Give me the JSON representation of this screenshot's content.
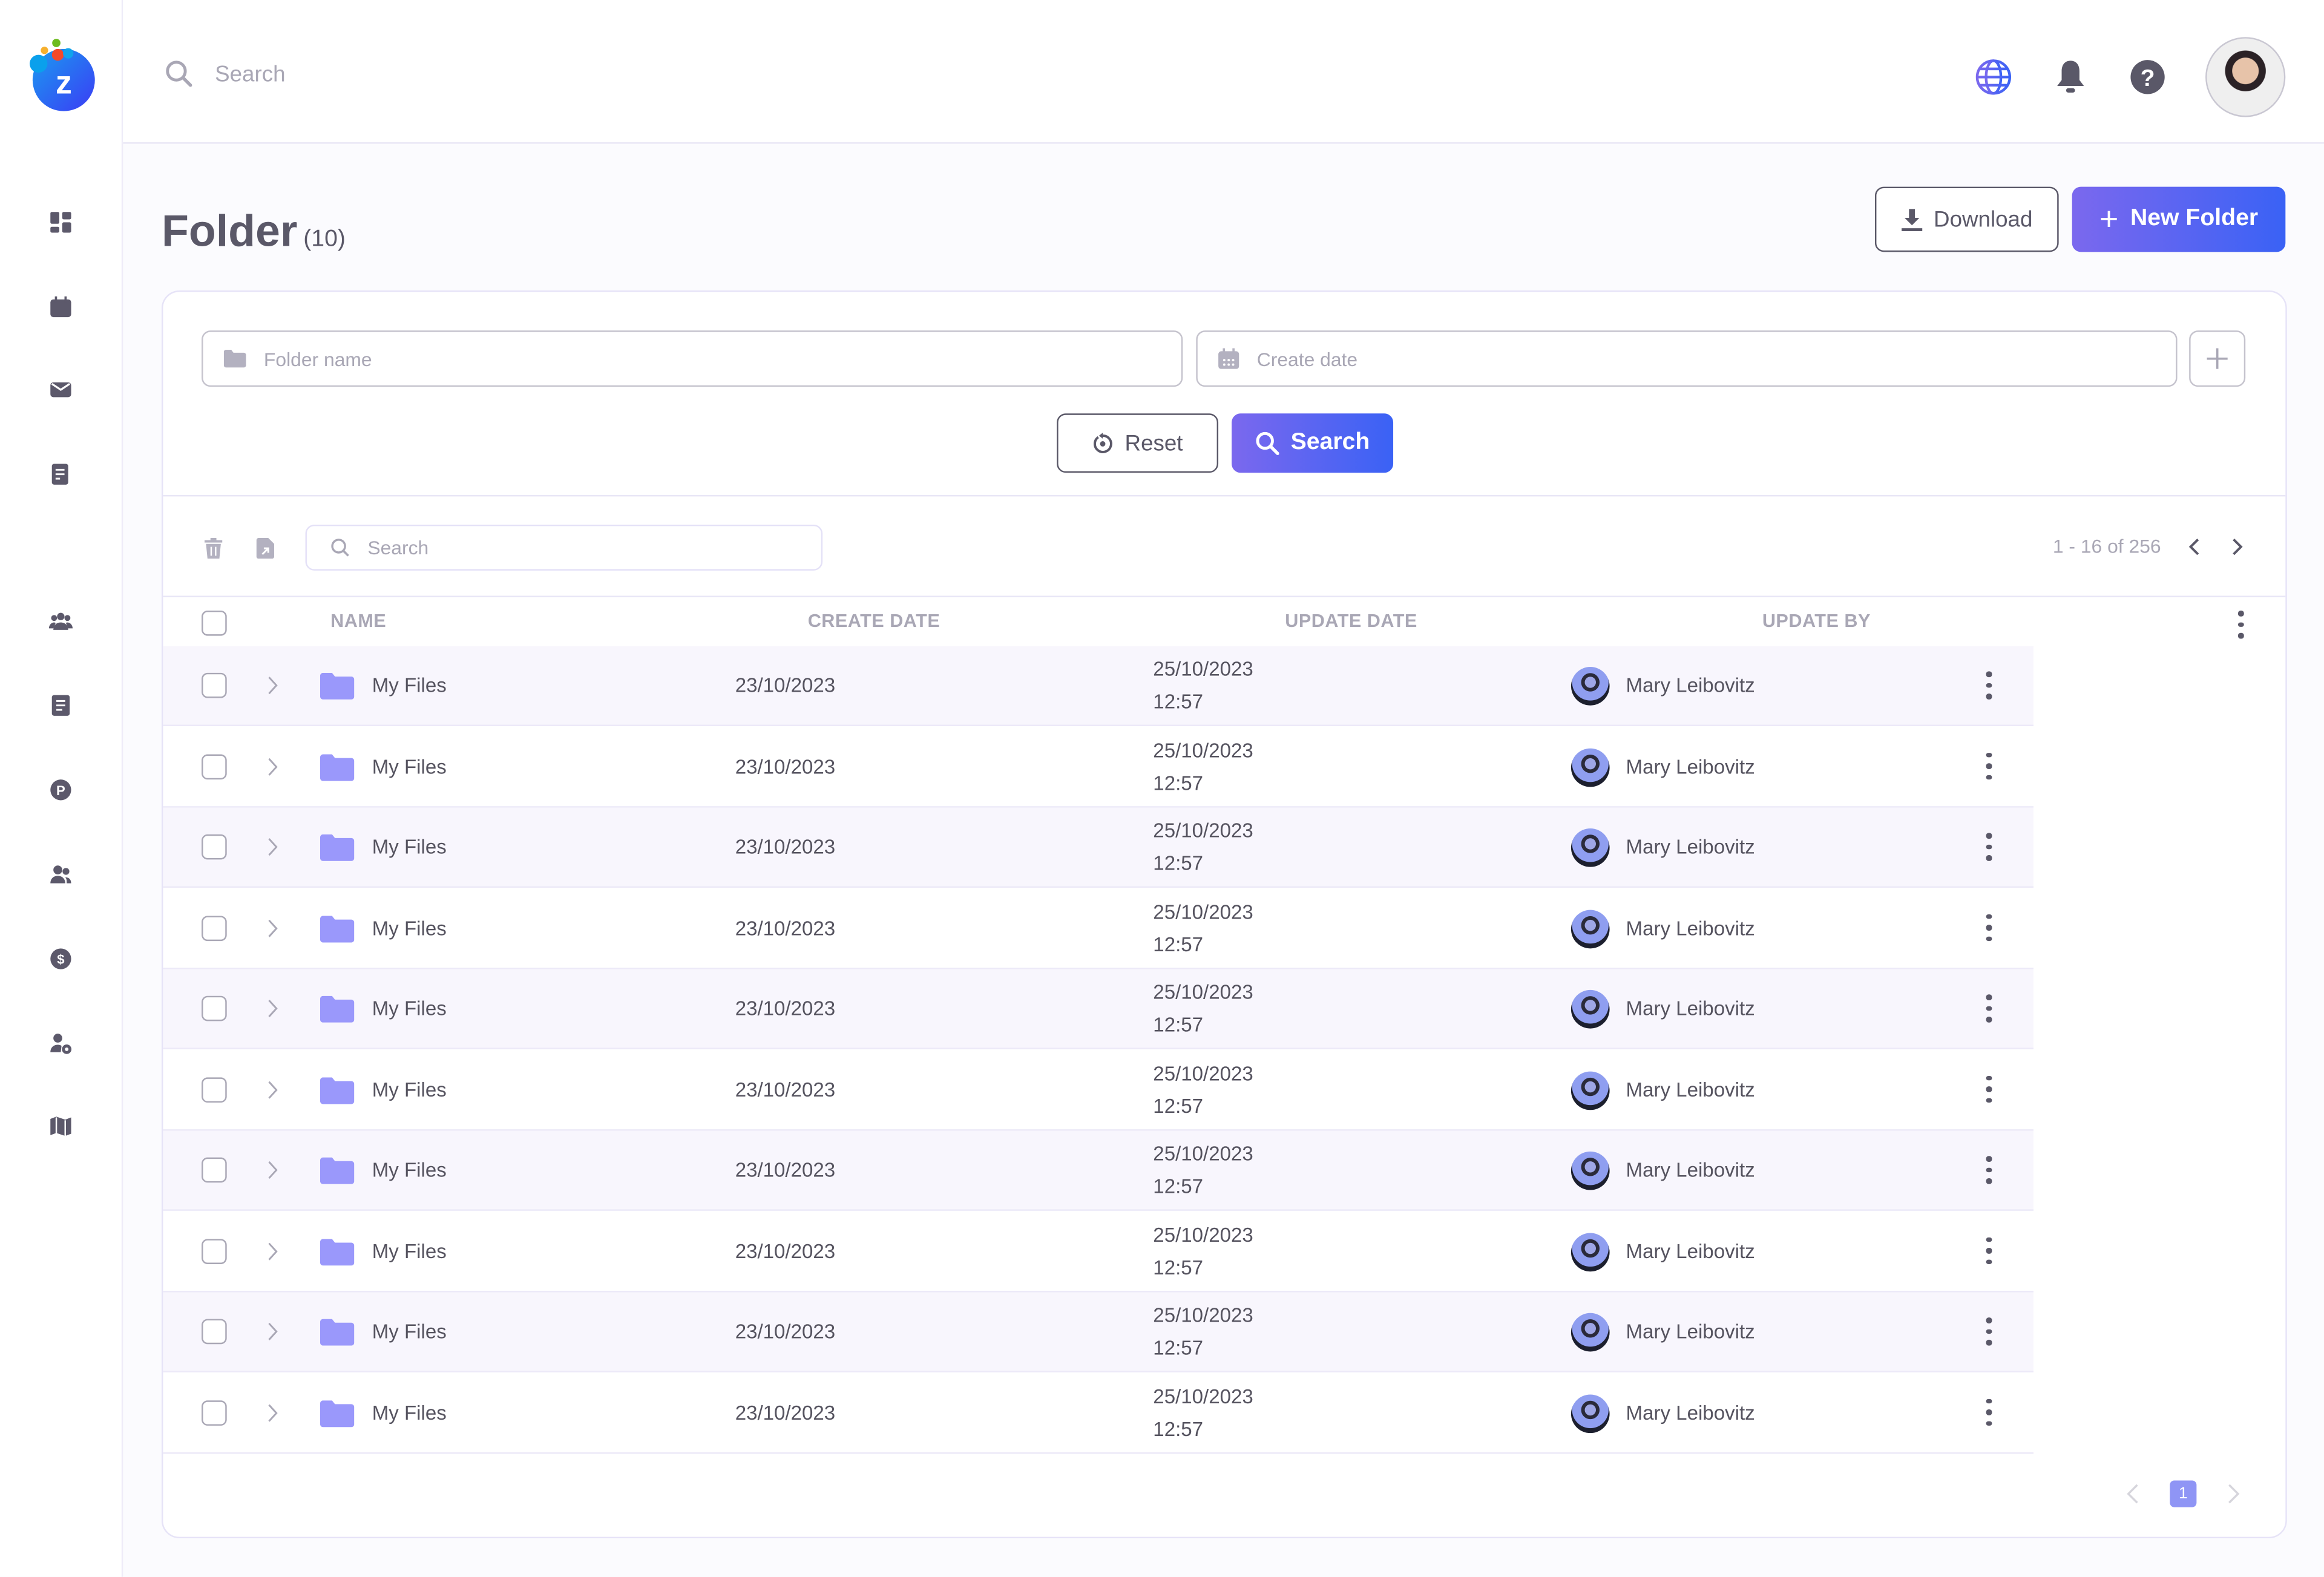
{
  "header": {
    "search_placeholder": "Search",
    "icons": [
      "globe-icon",
      "bell-icon",
      "help-icon"
    ]
  },
  "sidebar": {
    "items": [
      "dashboard",
      "calendar",
      "mail",
      "checklist",
      "team",
      "document",
      "points",
      "users",
      "billing",
      "user-settings",
      "map"
    ]
  },
  "page": {
    "title": "Folder",
    "count": "(10)",
    "download_label": "Download",
    "new_folder_label": "New Folder"
  },
  "filters": {
    "folder_name_placeholder": "Folder name",
    "create_date_placeholder": "Create date",
    "reset_label": "Reset",
    "search_label": "Search"
  },
  "table_toolbar": {
    "search_placeholder": "Search",
    "range": "1 - 16 of 256"
  },
  "columns": {
    "name": "NAME",
    "create_date": "CREATE DATE",
    "update_date": "UPDATE DATE",
    "update_by": "UPDATE BY"
  },
  "rows": [
    {
      "name": "My Files",
      "create_date": "23/10/2023",
      "update_date": "25/10/2023",
      "update_time": "12:57",
      "update_by": "Mary Leibovitz"
    },
    {
      "name": "My Files",
      "create_date": "23/10/2023",
      "update_date": "25/10/2023",
      "update_time": "12:57",
      "update_by": "Mary Leibovitz"
    },
    {
      "name": "My Files",
      "create_date": "23/10/2023",
      "update_date": "25/10/2023",
      "update_time": "12:57",
      "update_by": "Mary Leibovitz"
    },
    {
      "name": "My Files",
      "create_date": "23/10/2023",
      "update_date": "25/10/2023",
      "update_time": "12:57",
      "update_by": "Mary Leibovitz"
    },
    {
      "name": "My Files",
      "create_date": "23/10/2023",
      "update_date": "25/10/2023",
      "update_time": "12:57",
      "update_by": "Mary Leibovitz"
    },
    {
      "name": "My Files",
      "create_date": "23/10/2023",
      "update_date": "25/10/2023",
      "update_time": "12:57",
      "update_by": "Mary Leibovitz"
    },
    {
      "name": "My Files",
      "create_date": "23/10/2023",
      "update_date": "25/10/2023",
      "update_time": "12:57",
      "update_by": "Mary Leibovitz"
    },
    {
      "name": "My Files",
      "create_date": "23/10/2023",
      "update_date": "25/10/2023",
      "update_time": "12:57",
      "update_by": "Mary Leibovitz"
    },
    {
      "name": "My Files",
      "create_date": "23/10/2023",
      "update_date": "25/10/2023",
      "update_time": "12:57",
      "update_by": "Mary Leibovitz"
    },
    {
      "name": "My Files",
      "create_date": "23/10/2023",
      "update_date": "25/10/2023",
      "update_time": "12:57",
      "update_by": "Mary Leibovitz"
    }
  ],
  "pagination": {
    "current_page": "1"
  },
  "colors": {
    "accent_start": "#7b68ee",
    "accent_end": "#3a62f5",
    "folder": "#9a98fb",
    "text": "#5a5868",
    "row_alt": "#f8f6fd"
  }
}
